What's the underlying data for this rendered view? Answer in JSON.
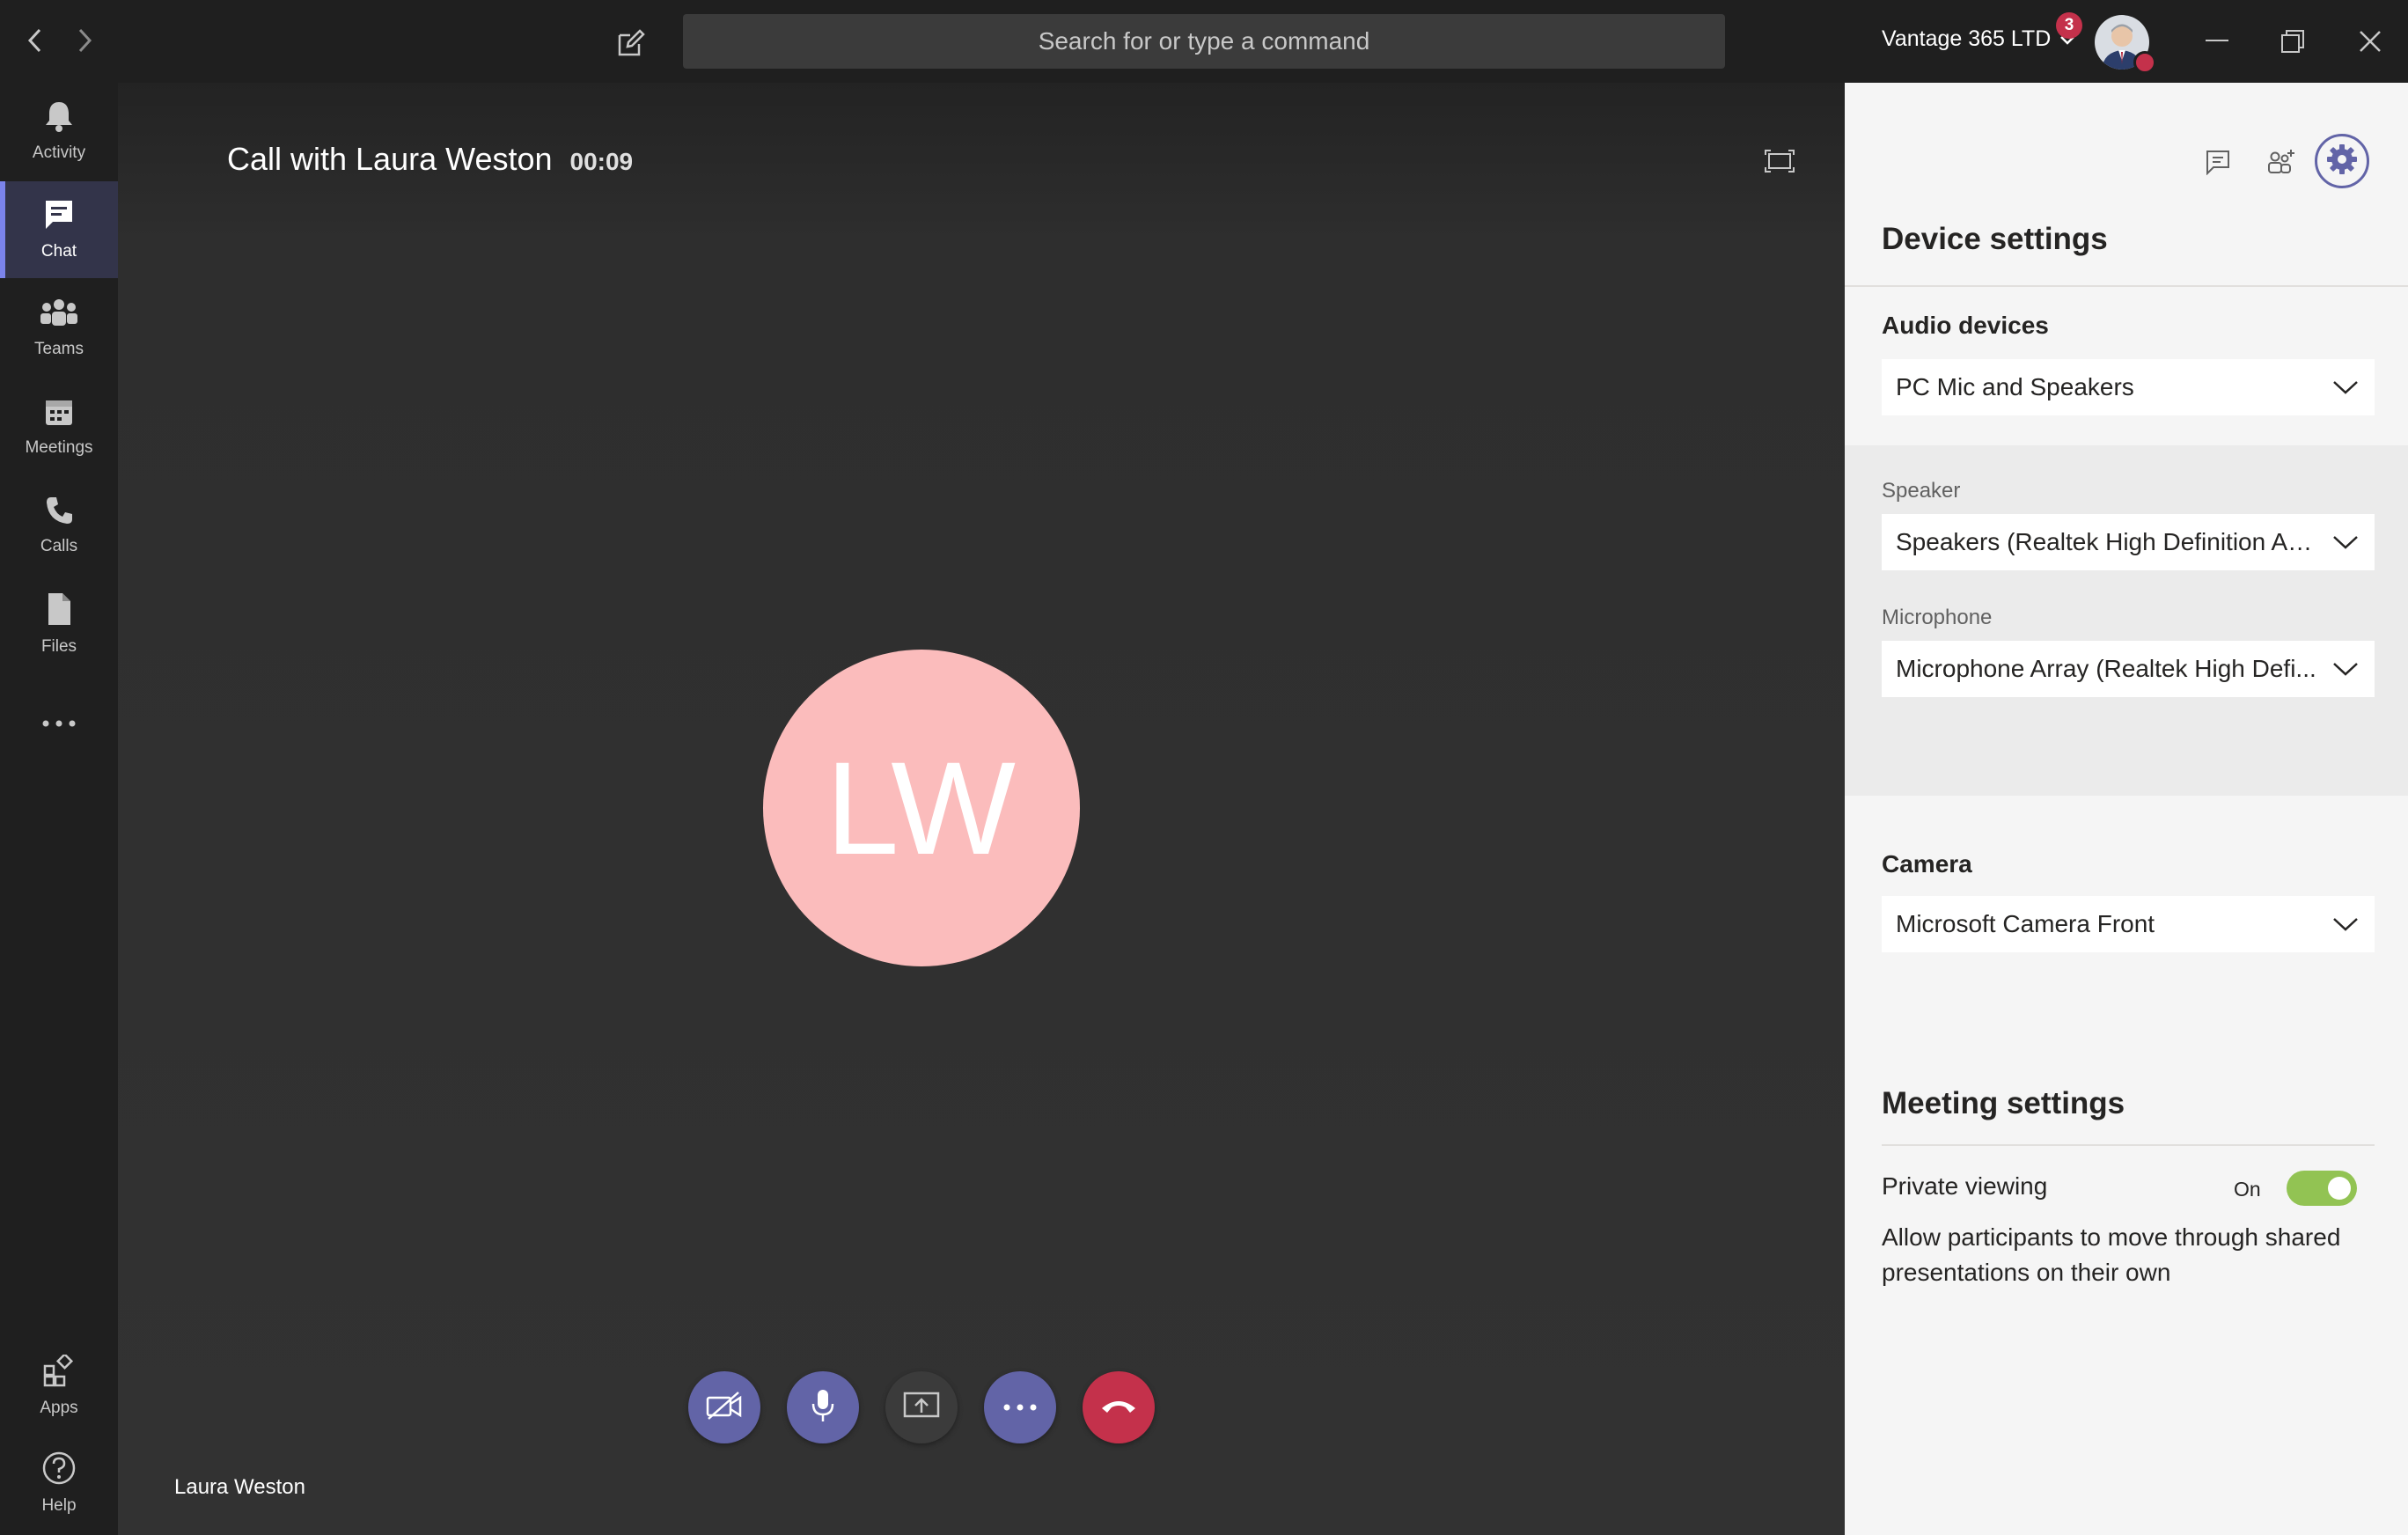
{
  "titlebar": {
    "search_placeholder": "Search for or type a command",
    "org_name": "Vantage 365 LTD",
    "notification_count": "3"
  },
  "rail": {
    "items": [
      {
        "label": "Activity",
        "icon": "bell-icon"
      },
      {
        "label": "Chat",
        "icon": "chat-icon"
      },
      {
        "label": "Teams",
        "icon": "teams-icon"
      },
      {
        "label": "Meetings",
        "icon": "calendar-icon"
      },
      {
        "label": "Calls",
        "icon": "phone-icon"
      },
      {
        "label": "Files",
        "icon": "file-icon"
      }
    ],
    "bottom": [
      {
        "label": "Apps",
        "icon": "apps-icon"
      },
      {
        "label": "Help",
        "icon": "help-icon"
      }
    ],
    "active": "Chat"
  },
  "call": {
    "title": "Call with Laura Weston",
    "timer": "00:09",
    "initials": "LW",
    "caller_name": "Laura Weston",
    "avatar_color": "#fbbcbc"
  },
  "panel": {
    "title": "Device settings",
    "audio_devices_label": "Audio devices",
    "audio_devices_value": "PC Mic and Speakers",
    "speaker_label": "Speaker",
    "speaker_value": "Speakers (Realtek High Definition Au...",
    "microphone_label": "Microphone",
    "microphone_value": "Microphone Array (Realtek High Defi...",
    "camera_label": "Camera",
    "camera_value": "Microsoft Camera Front",
    "meeting_settings_title": "Meeting settings",
    "private_viewing_label": "Private viewing",
    "private_viewing_state": "On",
    "private_viewing_desc": "Allow participants to move through shared presentations on their own"
  },
  "colors": {
    "accent": "#6264a7",
    "hangup": "#c4314b",
    "toggle_on": "#92c353"
  }
}
